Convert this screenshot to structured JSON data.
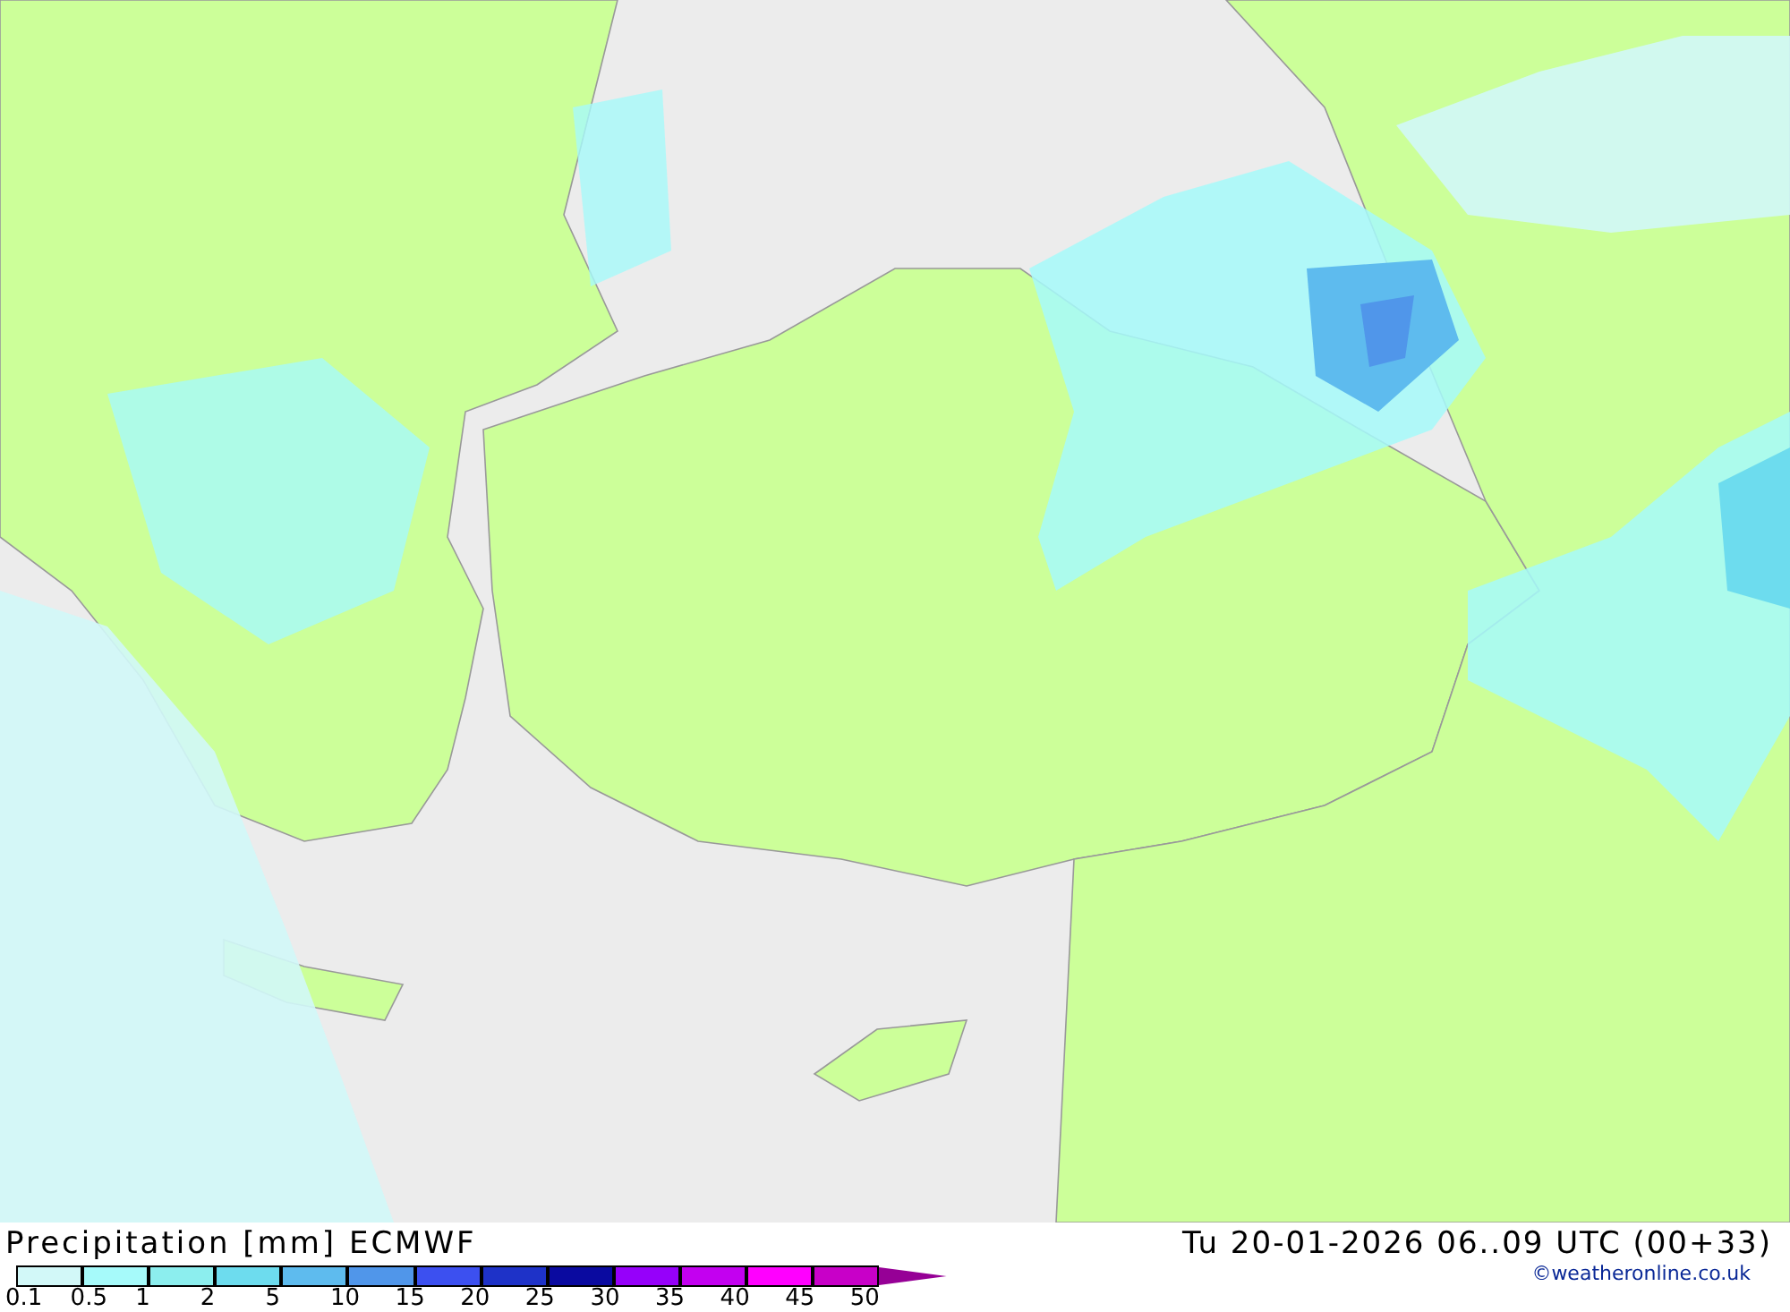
{
  "title": "Precipitation [mm] ECMWF",
  "valid_time": "Tu 20-01-2026 06..09 UTC (00+33)",
  "credit": "©weatheronline.co.uk",
  "legend": {
    "swatches": [
      {
        "kind": "box",
        "color": "#d2f8f8"
      },
      {
        "kind": "box",
        "color": "#a6fafa"
      },
      {
        "kind": "box",
        "color": "#8ceeee"
      },
      {
        "kind": "box",
        "color": "#6ddcee"
      },
      {
        "kind": "box",
        "color": "#5ebbee"
      },
      {
        "kind": "box",
        "color": "#5096ea"
      },
      {
        "kind": "box",
        "color": "#3c50f0"
      },
      {
        "kind": "box",
        "color": "#1e32c8"
      },
      {
        "kind": "box",
        "color": "#0a0aa0"
      },
      {
        "kind": "box",
        "color": "#9600fa"
      },
      {
        "kind": "box",
        "color": "#c300f0"
      },
      {
        "kind": "box",
        "color": "#ff00ff"
      },
      {
        "kind": "box",
        "color": "#c800c8"
      },
      {
        "kind": "arrow",
        "color": "#960096"
      }
    ],
    "labels": [
      "0.1",
      "0.5",
      "1",
      "2",
      "5",
      "10",
      "15",
      "20",
      "25",
      "30",
      "35",
      "40",
      "45",
      "50"
    ]
  }
}
